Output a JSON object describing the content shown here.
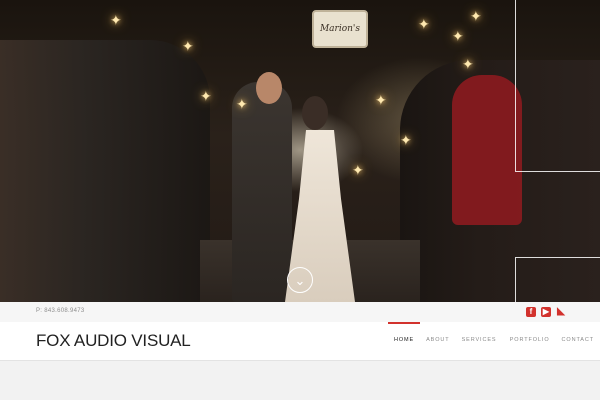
{
  "hero": {
    "sign_text": "Marion's",
    "scroll_icon": "chevron-down-icon"
  },
  "topbar": {
    "phone": "P: 843.608.9473",
    "social": [
      {
        "name": "facebook-icon",
        "glyph": "f"
      },
      {
        "name": "youtube-icon",
        "glyph": "▶"
      },
      {
        "name": "rss-icon",
        "glyph": "◣"
      }
    ]
  },
  "navbar": {
    "logo": "FOX AUDIO VISUAL",
    "items": [
      {
        "label": "HOME",
        "active": true
      },
      {
        "label": "ABOUT",
        "active": false
      },
      {
        "label": "SERVICES ▾",
        "active": false
      },
      {
        "label": "PORTFOLIO",
        "active": false
      },
      {
        "label": "CONTACT",
        "active": false
      }
    ],
    "accent": "#d2322d"
  }
}
